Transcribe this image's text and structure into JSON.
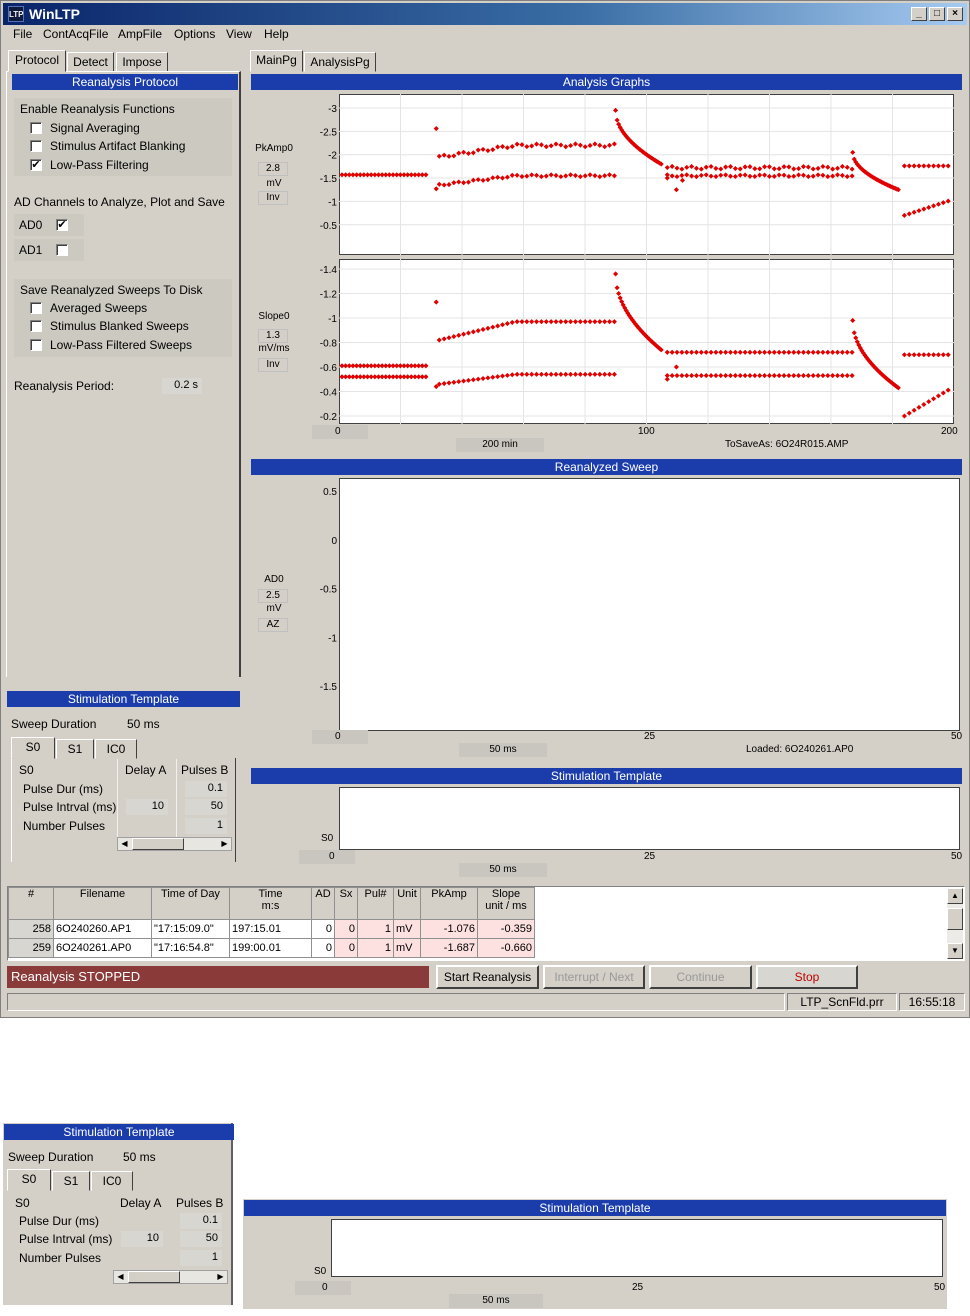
{
  "window": {
    "title": "WinLTP",
    "app_icon": "LTP"
  },
  "menu": [
    "File",
    "ContAcqFile",
    "AmpFile",
    "Options",
    "View",
    "Help"
  ],
  "left_tabs": [
    "Protocol",
    "Detect",
    "Impose"
  ],
  "right_tabs": [
    "MainPg",
    "AnalysisPg"
  ],
  "reanalysis": {
    "header": "Reanalysis Protocol",
    "enable_title": "Enable Reanalysis Functions",
    "enable_items": [
      {
        "label": "Signal Averaging",
        "checked": false
      },
      {
        "label": "Stimulus Artifact Blanking",
        "checked": false
      },
      {
        "label": "Low-Pass Filtering",
        "checked": true
      }
    ],
    "ad_title": "AD Channels to Analyze, Plot and Save",
    "ad0": "AD0",
    "ad0_checked": true,
    "ad1": "AD1",
    "ad1_checked": false,
    "save_title": "Save Reanalyzed Sweeps To Disk",
    "save_items": [
      {
        "label": "Averaged Sweeps",
        "checked": false
      },
      {
        "label": "Stimulus Blanked Sweeps",
        "checked": false
      },
      {
        "label": "Low-Pass Filtered Sweeps",
        "checked": false
      }
    ],
    "period_label": "Reanalysis Period:",
    "period_value": "0.2 s"
  },
  "stim_panel": {
    "header": "Stimulation Template",
    "sweep_label": "Sweep Duration",
    "sweep_value": "50 ms",
    "tabs": [
      "S0",
      "S1",
      "IC0"
    ],
    "corner": "S0",
    "col_delay": "Delay A",
    "col_pulses": "Pulses B",
    "rows": [
      {
        "label": "Pulse Dur (ms)",
        "delay": "",
        "pulses": "0.1"
      },
      {
        "label": "Pulse Intrval (ms)",
        "delay": "10",
        "pulses": "50"
      },
      {
        "label": "Number Pulses",
        "delay": "",
        "pulses": "1"
      }
    ]
  },
  "analysis": {
    "header": "Analysis Graphs",
    "pkamp": {
      "name": "PkAmp0",
      "value": "2.8",
      "unit": "mV",
      "mode": "Inv",
      "ticks": [
        "-3",
        "-2.5",
        "-2",
        "-1.5",
        "-1",
        "-0.5"
      ]
    },
    "slope": {
      "name": "Slope0",
      "value": "1.3",
      "unit": "mV/ms",
      "mode": "Inv",
      "ticks": [
        "-1.4",
        "-1.2",
        "-1",
        "-0.8",
        "-0.6",
        "-0.4",
        "-0.2"
      ]
    },
    "x_ticks": [
      "0",
      "100",
      "200"
    ],
    "x_unit": "200 min",
    "save_as": "ToSaveAs: 6O24R015.AMP"
  },
  "sweep": {
    "header": "Reanalyzed Sweep",
    "name": "AD0",
    "value": "2.5",
    "unit": "mV",
    "mode": "AZ",
    "y_ticks": [
      "0.5",
      "0",
      "-0.5",
      "-1",
      "-1.5"
    ],
    "x_ticks": [
      "0",
      "25",
      "50"
    ],
    "x_unit": "50 ms",
    "loaded": "Loaded: 6O240261.AP0"
  },
  "stim_graph": {
    "header": "Stimulation Template",
    "channel": "S0",
    "x_ticks": [
      "0",
      "25",
      "50"
    ],
    "x_unit": "50 ms"
  },
  "table": {
    "headers": [
      "#",
      "Filename",
      "Time of Day",
      "Time\nm:s",
      "AD",
      "Sx",
      "Pul#",
      "Unit",
      "PkAmp",
      "Slope\nunit / ms"
    ],
    "rows": [
      [
        "258",
        "6O240260.AP1",
        "\"17:15:09.0\"",
        "197:15.01",
        "0",
        "0",
        "1",
        "mV",
        "-1.076",
        "-0.359"
      ],
      [
        "259",
        "6O240261.AP0",
        "\"17:16:54.8\"",
        "199:00.01",
        "0",
        "0",
        "1",
        "mV",
        "-1.687",
        "-0.660"
      ]
    ]
  },
  "status": {
    "message": "Reanalysis STOPPED",
    "buttons": [
      "Start Reanalysis",
      "Interrupt / Next",
      "Continue",
      "Stop"
    ],
    "file": "LTP_ScnFld.prr",
    "clock": "16:55:18"
  },
  "colors": {
    "band": "#1b3dab",
    "red": "#e00000",
    "blue": "#1a1ad0",
    "status": "#8b3a3a"
  }
}
